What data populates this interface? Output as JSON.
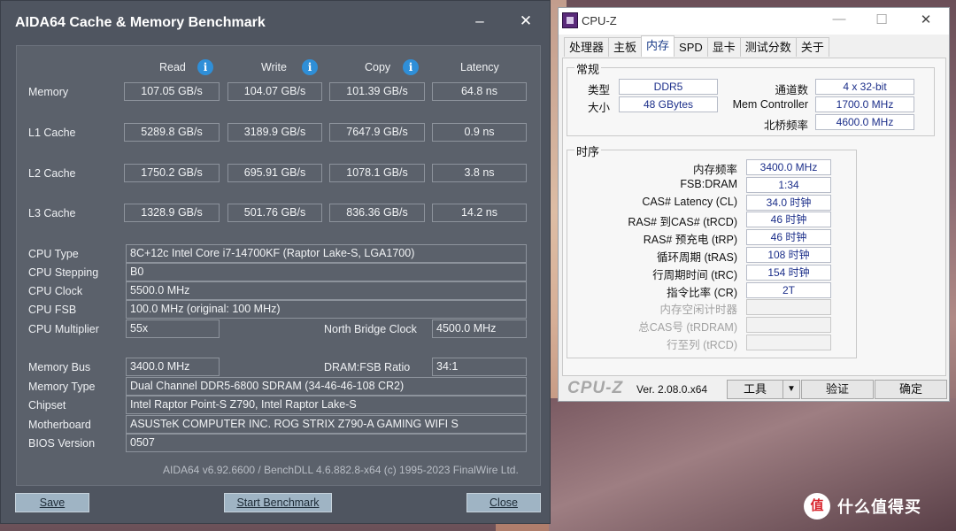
{
  "aida": {
    "title": "AIDA64 Cache & Memory Benchmark",
    "minimize": "–",
    "close_glyph": "✕",
    "columns": {
      "read": "Read",
      "write": "Write",
      "copy": "Copy",
      "latency": "Latency"
    },
    "info_glyph": "i",
    "bench": [
      {
        "label": "Memory",
        "read": "107.05 GB/s",
        "write": "104.07 GB/s",
        "copy": "101.39 GB/s",
        "latency": "64.8 ns"
      },
      {
        "label": "L1 Cache",
        "read": "5289.8 GB/s",
        "write": "3189.9 GB/s",
        "copy": "7647.9 GB/s",
        "latency": "0.9 ns"
      },
      {
        "label": "L2 Cache",
        "read": "1750.2 GB/s",
        "write": "695.91 GB/s",
        "copy": "1078.1 GB/s",
        "latency": "3.8 ns"
      },
      {
        "label": "L3 Cache",
        "read": "1328.9 GB/s",
        "write": "501.76 GB/s",
        "copy": "836.36 GB/s",
        "latency": "14.2 ns"
      }
    ],
    "cpu_type": {
      "label": "CPU Type",
      "value": "8C+12c Intel Core i7-14700KF  (Raptor Lake-S, LGA1700)"
    },
    "cpu_stepping": {
      "label": "CPU Stepping",
      "value": "B0"
    },
    "cpu_clock": {
      "label": "CPU Clock",
      "value": "5500.0 MHz"
    },
    "cpu_fsb": {
      "label": "CPU FSB",
      "value": "100.0 MHz  (original: 100 MHz)"
    },
    "cpu_multiplier": {
      "label": "CPU Multiplier",
      "value": "55x"
    },
    "nb_clock": {
      "label": "North Bridge Clock",
      "value": "4500.0 MHz"
    },
    "memory_bus": {
      "label": "Memory Bus",
      "value": "3400.0 MHz"
    },
    "dram_fsb": {
      "label": "DRAM:FSB Ratio",
      "value": "34:1"
    },
    "memory_type": {
      "label": "Memory Type",
      "value": "Dual Channel DDR5-6800 SDRAM  (34-46-46-108 CR2)"
    },
    "chipset": {
      "label": "Chipset",
      "value": "Intel Raptor Point-S Z790, Intel Raptor Lake-S"
    },
    "motherboard": {
      "label": "Motherboard",
      "value": "ASUSTeK COMPUTER INC. ROG STRIX Z790-A GAMING WIFI S"
    },
    "bios": {
      "label": "BIOS Version",
      "value": "0507"
    },
    "footer": "AIDA64 v6.92.6600 / BenchDLL 4.6.882.8-x64  (c) 1995-2023 FinalWire Ltd.",
    "buttons": {
      "save": "Save",
      "start": "Start Benchmark",
      "close": "Close"
    }
  },
  "cpuz": {
    "title": "CPU-Z",
    "window_controls": {
      "minimize": "—",
      "maximize": "☐",
      "close": "✕"
    },
    "tabs": [
      "处理器",
      "主板",
      "内存",
      "SPD",
      "显卡",
      "测试分数",
      "关于"
    ],
    "active_tab": "内存",
    "general": {
      "legend": "常规",
      "type_label": "类型",
      "type_value": "DDR5",
      "size_label": "大小",
      "size_value": "48 GBytes",
      "channels_label": "通道数",
      "channels_value": "4 x 32-bit",
      "memctrl_label": "Mem Controller",
      "memctrl_value": "1700.0 MHz",
      "nb_label": "北桥频率",
      "nb_value": "4600.0 MHz"
    },
    "timings": {
      "legend": "时序",
      "rows": [
        {
          "label": "内存频率",
          "value": "3400.0 MHz",
          "enabled": true
        },
        {
          "label": "FSB:DRAM",
          "value": "1:34",
          "enabled": true
        },
        {
          "label": "CAS# Latency (CL)",
          "value": "34.0 时钟",
          "enabled": true
        },
        {
          "label": "RAS# 到CAS# (tRCD)",
          "value": "46 时钟",
          "enabled": true
        },
        {
          "label": "RAS# 预充电 (tRP)",
          "value": "46 时钟",
          "enabled": true
        },
        {
          "label": "循环周期 (tRAS)",
          "value": "108 时钟",
          "enabled": true
        },
        {
          "label": "行周期时间 (tRC)",
          "value": "154 时钟",
          "enabled": true
        },
        {
          "label": "指令比率 (CR)",
          "value": "2T",
          "enabled": true
        },
        {
          "label": "内存空闲计时器",
          "value": "",
          "enabled": false
        },
        {
          "label": "总CAS号 (tRDRAM)",
          "value": "",
          "enabled": false
        },
        {
          "label": "行至列 (tRCD)",
          "value": "",
          "enabled": false
        }
      ]
    },
    "brand": "CPU-Z",
    "version": "Ver. 2.08.0.x64",
    "tools_label": "工具",
    "dropdown_glyph": "▼",
    "validate_label": "验证",
    "ok_label": "确定"
  },
  "watermark": {
    "badge": "值",
    "text": "什么值得买"
  },
  "icons": [
    "info-icon",
    "cpuz-logo-icon",
    "dropdown-arrow-icon",
    "close-icon",
    "minimize-icon",
    "maximize-icon"
  ]
}
